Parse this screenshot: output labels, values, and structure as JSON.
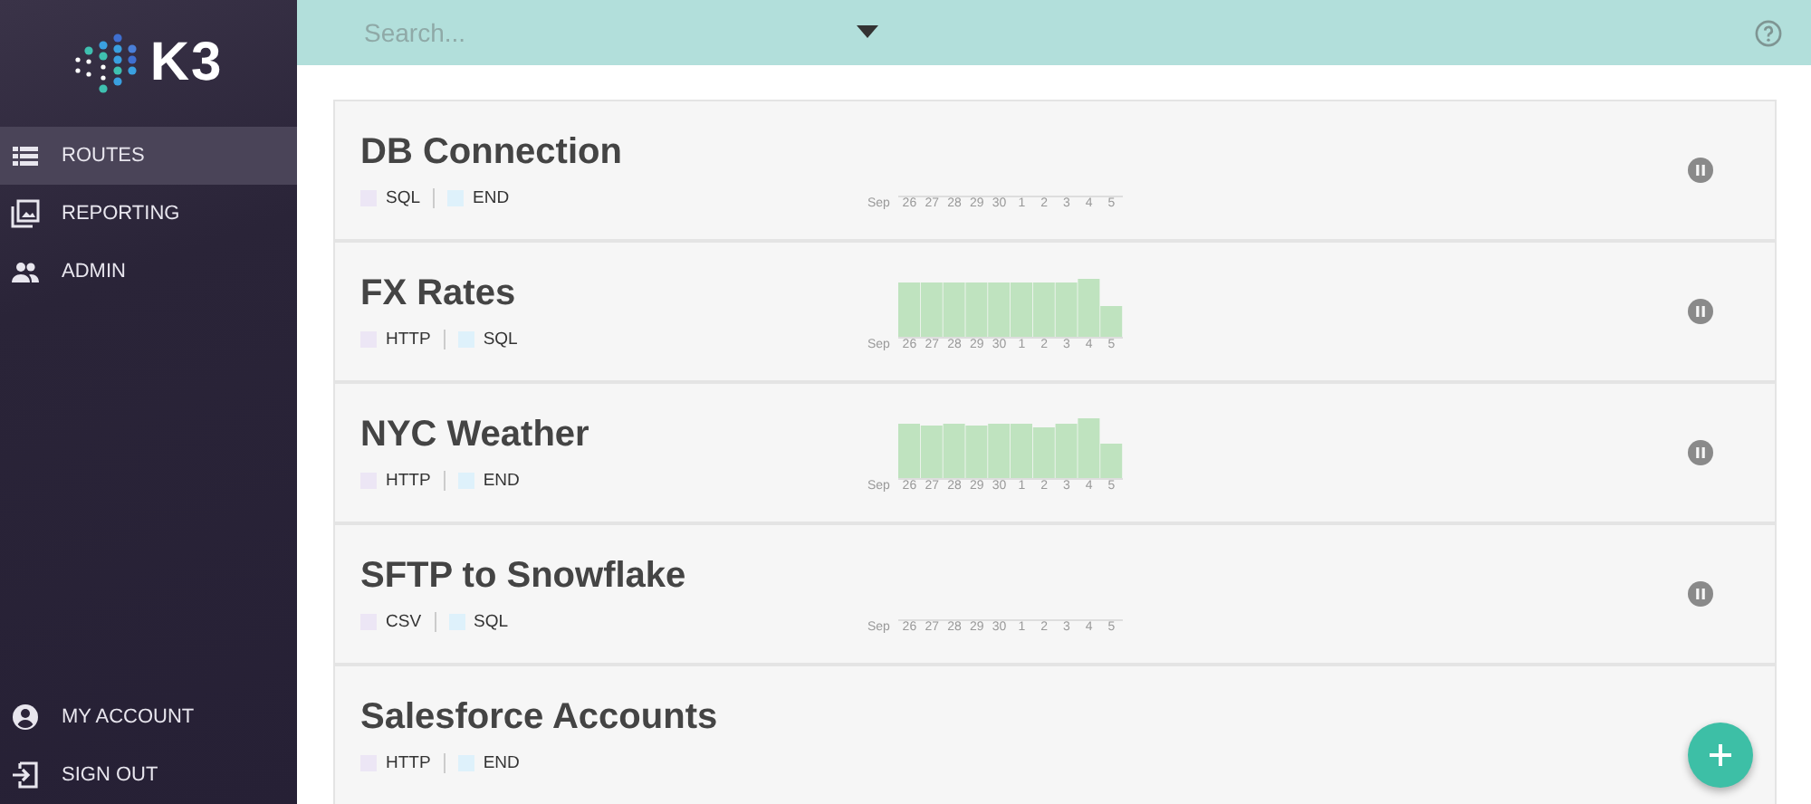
{
  "logo": {
    "text": "K3"
  },
  "sidebar": {
    "items": [
      {
        "label": "ROUTES",
        "selected": true
      },
      {
        "label": "REPORTING",
        "selected": false
      },
      {
        "label": "ADMIN",
        "selected": false
      }
    ],
    "bottom_items": [
      {
        "label": "MY ACCOUNT"
      },
      {
        "label": "SIGN OUT"
      }
    ]
  },
  "search": {
    "placeholder": "Search..."
  },
  "routes": [
    {
      "name": "DB Connection",
      "tags": [
        {
          "label": "SQL",
          "color": "#ece6f5"
        },
        {
          "label": "END",
          "color": "#def1fb"
        }
      ],
      "kind": "empty",
      "ticks": [
        "Sep",
        "26",
        "27",
        "28",
        "29",
        "30",
        "1",
        "2",
        "3",
        "4",
        "5"
      ]
    },
    {
      "name": "FX Rates",
      "tags": [
        {
          "label": "HTTP",
          "color": "#ece6f5"
        },
        {
          "label": "SQL",
          "color": "#def1fb"
        }
      ],
      "kind": "bars",
      "ticks": [
        "Sep",
        "26",
        "27",
        "28",
        "29",
        "30",
        "1",
        "2",
        "3",
        "4",
        "5"
      ]
    },
    {
      "name": "NYC Weather",
      "tags": [
        {
          "label": "HTTP",
          "color": "#ece6f5"
        },
        {
          "label": "END",
          "color": "#def1fb"
        }
      ],
      "kind": "bars",
      "ticks": [
        "Sep",
        "26",
        "27",
        "28",
        "29",
        "30",
        "1",
        "2",
        "3",
        "4",
        "5"
      ]
    },
    {
      "name": "SFTP to Snowflake",
      "tags": [
        {
          "label": "CSV",
          "color": "#ece6f5"
        },
        {
          "label": "SQL",
          "color": "#def1fb"
        }
      ],
      "kind": "empty",
      "ticks": [
        "Sep",
        "26",
        "27",
        "28",
        "29",
        "30",
        "1",
        "2",
        "3",
        "4",
        "5"
      ]
    },
    {
      "name": "Salesforce Accounts",
      "tags": [
        {
          "label": "HTTP",
          "color": "#ece6f5"
        },
        {
          "label": "END",
          "color": "#def1fb"
        }
      ]
    }
  ]
}
